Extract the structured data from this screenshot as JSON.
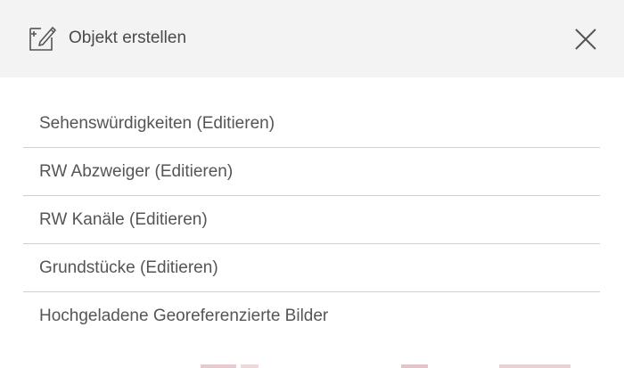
{
  "dialog": {
    "title": "Objekt erstellen",
    "icons": {
      "header": "create-object-icon",
      "close": "close-icon"
    }
  },
  "layers": [
    {
      "label": "Sehenswürdigkeiten (Editieren)"
    },
    {
      "label": "RW Abzweiger (Editieren)"
    },
    {
      "label": "RW Kanäle (Editieren)"
    },
    {
      "label": "Grundstücke (Editieren)"
    },
    {
      "label": "Hochgeladene Georeferenzierte Bilder"
    }
  ],
  "colors": {
    "header_bg": "#f3f3f3",
    "text": "#555555",
    "divider": "#cfcfcf"
  }
}
